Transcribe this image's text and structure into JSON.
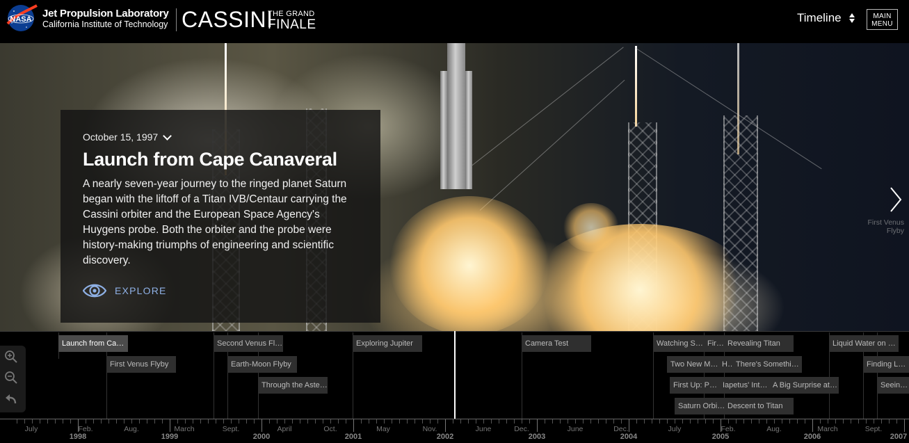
{
  "header": {
    "org_title": "Jet Propulsion Laboratory",
    "org_subtitle": "California Institute of Technology",
    "nasa_logo_text": "NASA",
    "mission_name": "CASSINI",
    "mission_tag_line1": "THE GRAND",
    "mission_tag_line2": "FINALE",
    "view_select_label": "Timeline",
    "main_menu_line1": "MAIN",
    "main_menu_line2": "MENU"
  },
  "hero": {
    "date": "October 15, 1997",
    "title": "Launch from Cape Canaveral",
    "description": "A nearly seven-year journey to the ringed planet Saturn began with the liftoff of a Titan IVB/Centaur carrying the Cassini orbiter and the European Space Agency's Huygens probe. Both the orbiter and the probe were history-making triumphs of engineering and scientific discovery.",
    "explore_label": "EXPLORE",
    "next_event_label": "First Venus Flyby"
  },
  "timeline": {
    "events": [
      {
        "label": "Launch from Cape Canaveral",
        "active": true
      },
      {
        "label": "First Venus Flyby"
      },
      {
        "label": "Second Venus Flyby"
      },
      {
        "label": "Earth-Moon Flyby"
      },
      {
        "label": "Through the Asteroid Belt"
      },
      {
        "label": "Exploring Jupiter"
      },
      {
        "label": "Camera Test"
      },
      {
        "label": "Watching Saturn"
      },
      {
        "label": "Two New Moons"
      },
      {
        "label": "First Up: Phoebe"
      },
      {
        "label": "Saturn Orbit Insertion"
      },
      {
        "label": "First Titan Flyby"
      },
      {
        "label": "Huygens Release"
      },
      {
        "label": "Iapetus' Interesting Ridge"
      },
      {
        "label": "Revealing Titan"
      },
      {
        "label": "There's Something About Enceladus"
      },
      {
        "label": "A Big Surprise at Enceladus"
      },
      {
        "label": "Descent to Titan"
      },
      {
        "label": "Liquid Water on Enceladus"
      },
      {
        "label": "Finding Lakes on Titan"
      },
      {
        "label": "Seeing New Rings"
      }
    ],
    "axis": [
      {
        "label": "July"
      },
      {
        "label": "Feb."
      },
      {
        "label": "Aug."
      },
      {
        "label": "March"
      },
      {
        "label": "Sept."
      },
      {
        "label": "April"
      },
      {
        "label": "Oct."
      },
      {
        "label": "May"
      },
      {
        "label": "Nov."
      },
      {
        "label": "June"
      },
      {
        "label": "Dec."
      },
      {
        "label": "June"
      },
      {
        "label": "Dec."
      },
      {
        "label": "July"
      },
      {
        "label": "Feb."
      },
      {
        "label": "Aug."
      },
      {
        "label": "March"
      },
      {
        "label": "Sept."
      }
    ],
    "years": [
      "1998",
      "1999",
      "2000",
      "2001",
      "2002",
      "2003",
      "2004",
      "2005",
      "2006",
      "2007"
    ]
  }
}
